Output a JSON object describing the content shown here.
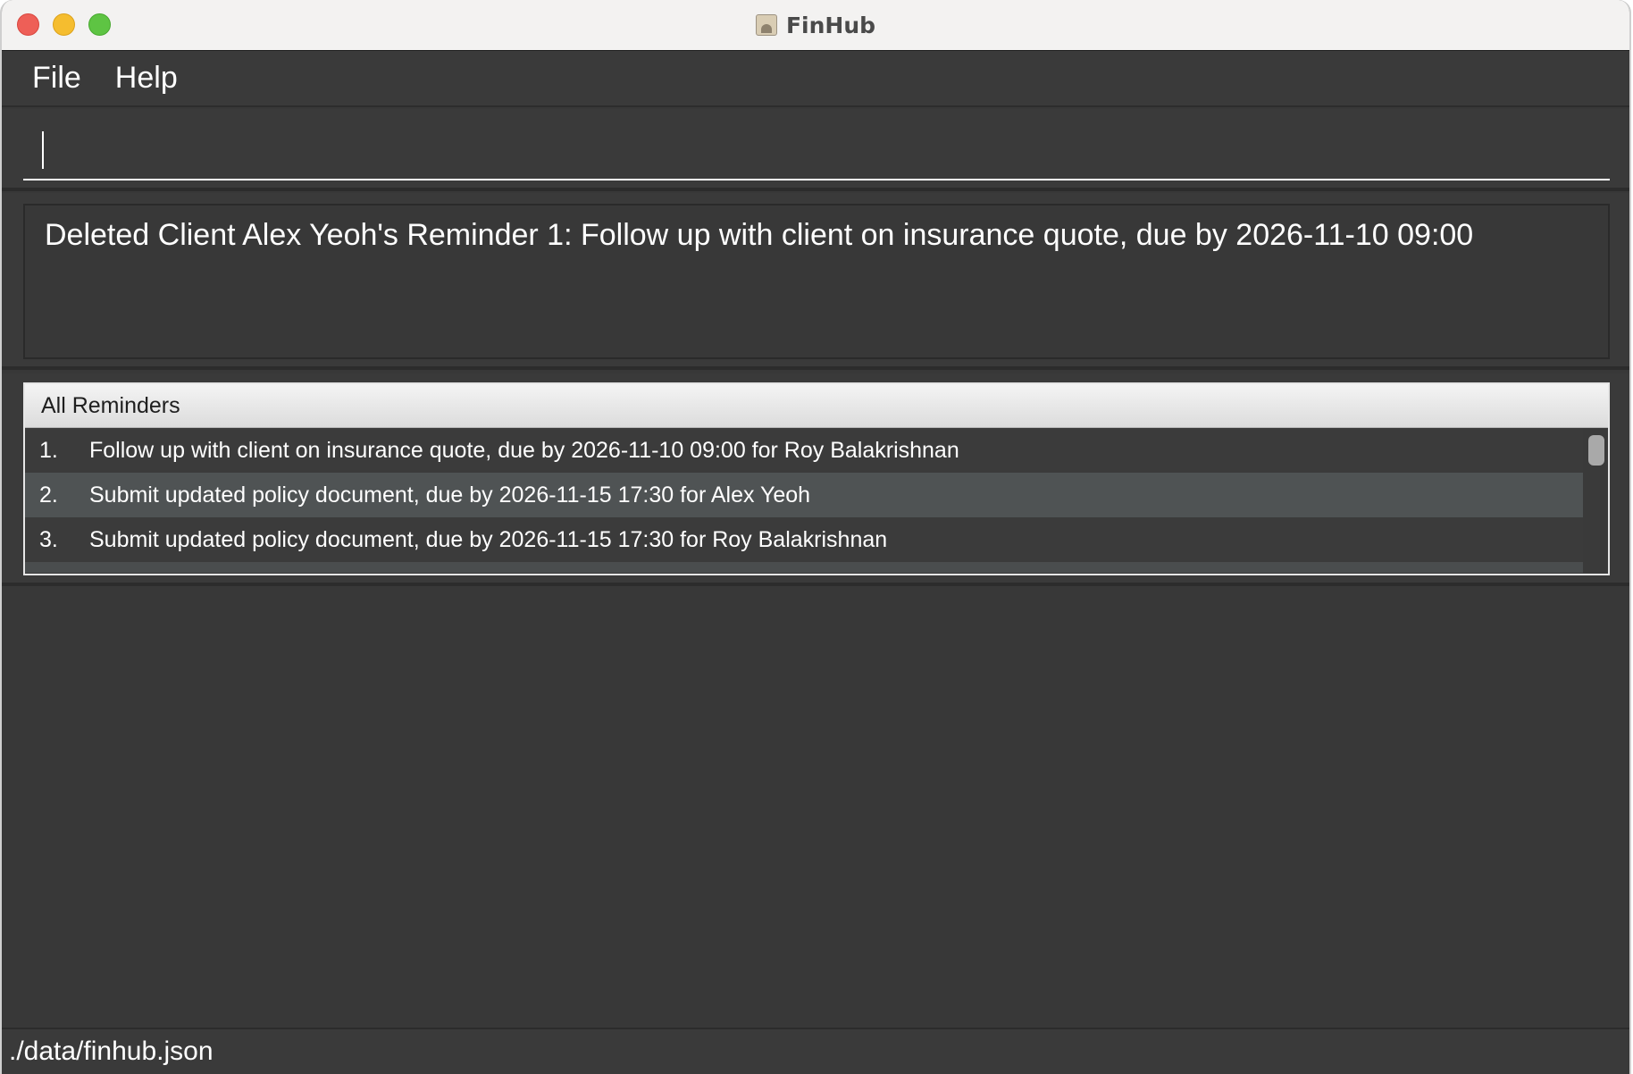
{
  "window": {
    "title": "FinHub",
    "icon": "address-book-icon"
  },
  "menubar": {
    "file_label": "File",
    "help_label": "Help"
  },
  "command": {
    "value": "",
    "placeholder": ""
  },
  "result": {
    "message": "Deleted Client Alex Yeoh's Reminder 1: Follow up with client on insurance quote, due by 2026-11-10 09:00"
  },
  "reminders": {
    "header": "All Reminders",
    "items": [
      {
        "index": "1.",
        "text": "Follow up with client on insurance quote, due by 2026-11-10 09:00 for Roy Balakrishnan"
      },
      {
        "index": "2.",
        "text": "Submit updated policy document, due by 2026-11-15 17:30 for Alex Yeoh"
      },
      {
        "index": "3.",
        "text": "Submit updated policy document, due by 2026-11-15 17:30 for Roy Balakrishnan"
      }
    ]
  },
  "status": {
    "file_path": "./data/finhub.json"
  },
  "colors": {
    "background": "#383838",
    "selected_row": "#4f5354",
    "close": "#ee5f57",
    "minimize": "#f5bd2f",
    "maximize": "#5ec443"
  }
}
